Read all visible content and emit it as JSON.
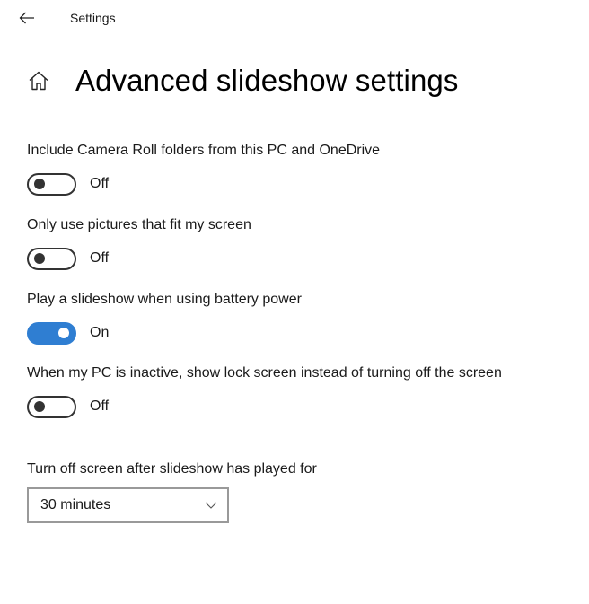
{
  "window": {
    "title": "Settings"
  },
  "page": {
    "title": "Advanced slideshow settings"
  },
  "settings": [
    {
      "label": "Include Camera Roll folders from this PC and OneDrive",
      "state": "Off",
      "on": false
    },
    {
      "label": "Only use pictures that fit my screen",
      "state": "Off",
      "on": false
    },
    {
      "label": "Play a slideshow when using battery power",
      "state": "On",
      "on": true
    },
    {
      "label": "When my PC is inactive, show lock screen instead of turning off the screen",
      "state": "Off",
      "on": false
    }
  ],
  "screen_off": {
    "label": "Turn off screen after slideshow has played for",
    "selected": "30 minutes"
  },
  "colors": {
    "accent": "#2f7ed2"
  }
}
